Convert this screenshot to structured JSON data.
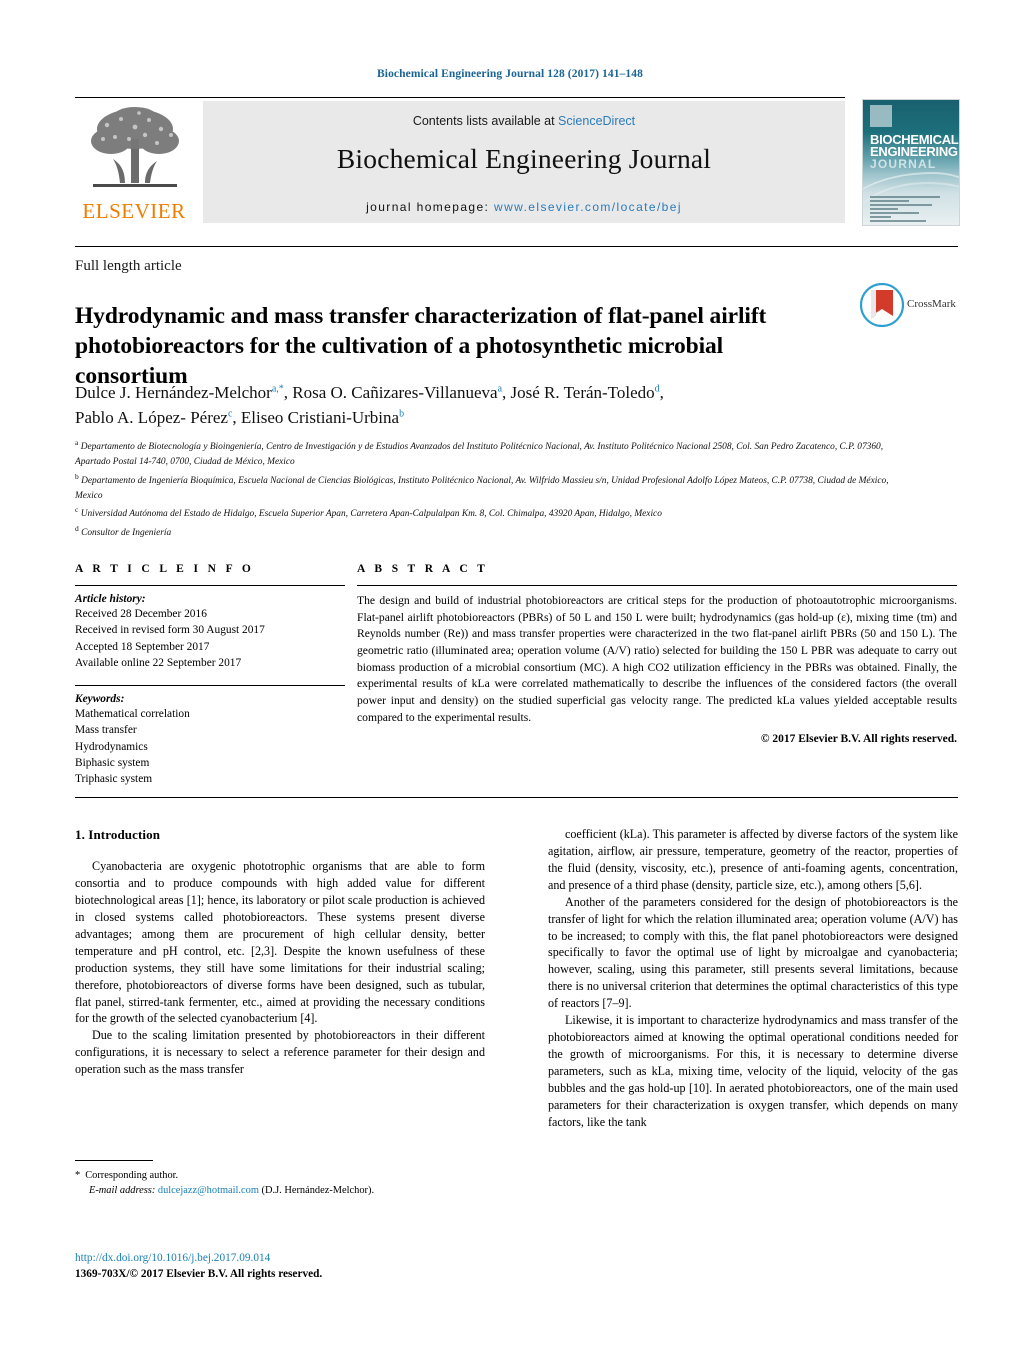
{
  "running_head": "Biochemical Engineering Journal 128 (2017) 141–148",
  "masthead": {
    "contents_prefix": "Contents lists available at ",
    "sciencedirect": "ScienceDirect",
    "journal_title": "Biochemical Engineering Journal",
    "homepage_prefix": "journal homepage: ",
    "homepage_url": "www.elsevier.com/locate/bej",
    "publisher_name": "ELSEVIER",
    "accent_link": "#2b7bb9",
    "publisher_color": "#ef7d00"
  },
  "cover": {
    "line1": "BIOCHEMICAL",
    "line2": "ENGINEERING",
    "line3": "JOURNAL"
  },
  "article": {
    "type": "Full length article",
    "title": "Hydrodynamic and mass transfer characterization of flat-panel airlift photobioreactors for the cultivation of a photosynthetic microbial consortium",
    "crossmark_label": "CrossMark"
  },
  "authors": {
    "line1_parts": [
      {
        "name": "Dulce J. Hernández-Melchor",
        "sup": "a,*"
      },
      {
        "name": "Rosa O. Cañizares-Villanueva",
        "sup": "a"
      },
      {
        "name": "José R. Terán-Toledo",
        "sup": "d"
      }
    ],
    "line2_parts": [
      {
        "name": "Pablo A. López- Pérez",
        "sup": "c"
      },
      {
        "name": "Eliseo Cristiani-Urbina",
        "sup": "b"
      }
    ]
  },
  "affiliations": [
    {
      "marker": "a",
      "text": "Departamento de Biotecnología y Bioingeniería, Centro de Investigación y de Estudios Avanzados del Instituto Politécnico Nacional, Av. Instituto Politécnico Nacional 2508, Col. San Pedro Zacatenco, C.P. 07360, Apartado Postal 14-740, 0700, Ciudad de México, Mexico"
    },
    {
      "marker": "b",
      "text": "Departamento de Ingeniería Bioquímica, Escuela Nacional de Ciencias Biológicas, Instituto Politécnico Nacional, Av. Wilfrido Massieu s/n, Unidad Profesional Adolfo López Mateos, C.P. 07738, Ciudad de México, Mexico"
    },
    {
      "marker": "c",
      "text": "Universidad Autónoma del Estado de Hidalgo, Escuela Superior Apan, Carretera Apan-Calpulalpan Km. 8, Col. Chimalpa, 43920 Apan, Hidalgo, Mexico"
    },
    {
      "marker": "d",
      "text": "Consultor de Ingeniería"
    }
  ],
  "article_info": {
    "heading": "A R T I C L E   I N F O",
    "history_label": "Article history:",
    "history": [
      "Received 28 December 2016",
      "Received in revised form 30 August 2017",
      "Accepted 18 September 2017",
      "Available online 22 September 2017"
    ],
    "keywords_label": "Keywords:",
    "keywords": [
      "Mathematical correlation",
      "Mass transfer",
      "Hydrodynamics",
      "Biphasic system",
      "Triphasic system"
    ]
  },
  "abstract": {
    "heading": "A B S T R A C T",
    "text": "The design and build of industrial photobioreactors are critical steps for the production of photoautotrophic microorganisms. Flat-panel airlift photobioreactors (PBRs) of 50 L and 150 L were built; hydrodynamics (gas hold-up (ε), mixing time (tm) and Reynolds number (Re)) and mass transfer properties were characterized in the two flat-panel airlift PBRs (50 and 150 L). The geometric ratio (illuminated area; operation volume (A/V) ratio) selected for building the 150 L PBR was adequate to carry out biomass production of a microbial consortium (MC). A high CO2 utilization efficiency in the PBRs was obtained. Finally, the experimental results of kLa were correlated mathematically to describe the influences of the considered factors (the overall power input and density) on the studied superficial gas velocity range. The predicted kLa values yielded acceptable results compared to the experimental results.",
    "copyright": "© 2017 Elsevier B.V. All rights reserved."
  },
  "body": {
    "section_heading": "1.  Introduction",
    "left_paragraphs": [
      "Cyanobacteria are oxygenic phototrophic organisms that are able to form consortia and to produce compounds with high added value for different biotechnological areas [1]; hence, its laboratory or pilot scale production is achieved in closed systems called photobioreactors. These systems present diverse advantages; among them are procurement of high cellular density, better temperature and pH control, etc. [2,3]. Despite the known usefulness of these production systems, they still have some limitations for their industrial scaling; therefore, photobioreactors of diverse forms have been designed, such as tubular, flat panel, stirred-tank fermenter, etc., aimed at providing the necessary conditions for the growth of the selected cyanobacterium [4].",
      "Due to the scaling limitation presented by photobioreactors in their different configurations, it is necessary to select a reference parameter for their design and operation such as the mass transfer"
    ],
    "right_paragraphs": [
      "coefficient (kLa). This parameter is affected by diverse factors of the system like agitation, airflow, air pressure, temperature, geometry of the reactor, properties of the fluid (density, viscosity, etc.), presence of anti-foaming agents, concentration, and presence of a third phase (density, particle size, etc.), among others [5,6].",
      "Another of the parameters considered for the design of photobioreactors is the transfer of light for which the relation illuminated area; operation volume (A/V) has to be increased; to comply with this, the flat panel photobioreactors were designed specifically to favor the optimal use of light by microalgae and cyanobacteria; however, scaling, using this parameter, still presents several limitations, because there is no universal criterion that determines the optimal characteristics of this type of reactors [7–9].",
      "Likewise, it is important to characterize hydrodynamics and mass transfer of the photobioreactors aimed at knowing the optimal operational conditions needed for the growth of microorganisms. For this, it is necessary to determine diverse parameters, such as kLa, mixing time, velocity of the liquid, velocity of the gas bubbles and the gas hold-up [10]. In aerated photobioreactors, one of the main used parameters for their characterization is oxygen transfer, which depends on many factors, like the tank"
    ]
  },
  "footnote": {
    "star": "*",
    "corresponding": "Corresponding author.",
    "email_label": "E-mail address:",
    "email": "dulcejazz@hotmail.com",
    "email_attribution": "(D.J. Hernández-Melchor)."
  },
  "footer": {
    "doi": "http://dx.doi.org/10.1016/j.bej.2017.09.014",
    "issn": "1369-703X/© 2017 Elsevier B.V. All rights reserved."
  }
}
